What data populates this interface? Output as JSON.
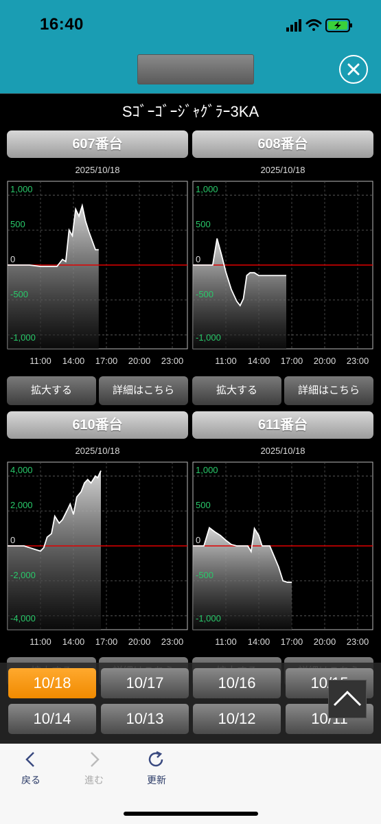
{
  "status": {
    "time": "16:40"
  },
  "title": "Sｺﾞｰｺﾞｰｼﾞｬｸﾞﾗｰ3KA",
  "buttons": {
    "zoom": "拡大する",
    "detail": "詳細はこちら"
  },
  "colors": {
    "header": "#1a9db3",
    "zero_line": "#e00000",
    "axis_label": "#29c96a",
    "active_date": "#f59a1c"
  },
  "panels": [
    {
      "title": "607番台",
      "date": "2025/10/18"
    },
    {
      "title": "608番台",
      "date": "2025/10/18"
    },
    {
      "title": "610番台",
      "date": "2025/10/18"
    },
    {
      "title": "611番台",
      "date": "2025/10/18"
    }
  ],
  "chart_data": [
    {
      "type": "area",
      "title": "607番台",
      "subtitle": "2025/10/18",
      "x_ticks": [
        "11:00",
        "14:00",
        "17:00",
        "20:00",
        "23:00"
      ],
      "y_ticks": [
        "1,000",
        "500",
        "0",
        "-500",
        "-1,000"
      ],
      "ylim": [
        -1100,
        1100
      ],
      "x": [
        8.0,
        9.0,
        10.0,
        11.0,
        11.5,
        12.0,
        12.5,
        13.0,
        13.3,
        13.6,
        13.9,
        14.2,
        14.5,
        14.8,
        15.1,
        15.4,
        15.7,
        16.0,
        16.3
      ],
      "y": [
        0,
        0,
        0,
        -20,
        -20,
        -20,
        -20,
        80,
        50,
        500,
        420,
        800,
        700,
        850,
        630,
        480,
        350,
        220,
        220
      ]
    },
    {
      "type": "area",
      "title": "608番台",
      "subtitle": "2025/10/18",
      "x_ticks": [
        "11:00",
        "14:00",
        "17:00",
        "20:00",
        "23:00"
      ],
      "y_ticks": [
        "1,000",
        "500",
        "0",
        "-500",
        "-1,000"
      ],
      "ylim": [
        -1100,
        1100
      ],
      "x": [
        8.0,
        9.0,
        9.8,
        10.2,
        10.6,
        11.0,
        11.5,
        12.0,
        12.3,
        12.6,
        12.9,
        13.2,
        13.6,
        14.0,
        15.0,
        16.0,
        16.5
      ],
      "y": [
        0,
        0,
        0,
        380,
        150,
        -100,
        -350,
        -520,
        -580,
        -480,
        -150,
        -110,
        -110,
        -150,
        -150,
        -150,
        -150
      ]
    },
    {
      "type": "area",
      "title": "610番台",
      "subtitle": "2025/10/18",
      "x_ticks": [
        "11:00",
        "14:00",
        "17:00",
        "20:00",
        "23:00"
      ],
      "y_ticks": [
        "4,000",
        "2,000",
        "0",
        "-2,000",
        "-4,000"
      ],
      "ylim": [
        -4400,
        4400
      ],
      "x": [
        8.0,
        9.5,
        10.0,
        10.5,
        11.0,
        11.3,
        11.6,
        12.0,
        12.3,
        12.7,
        13.0,
        13.4,
        13.7,
        14.0,
        14.3,
        14.7,
        15.0,
        15.3,
        15.6,
        16.0,
        16.2,
        16.5
      ],
      "y": [
        0,
        0,
        -100,
        -200,
        -300,
        -100,
        500,
        700,
        1700,
        1300,
        1500,
        2000,
        2400,
        1800,
        2800,
        3100,
        3600,
        3800,
        3600,
        4000,
        3900,
        4300
      ]
    },
    {
      "type": "area",
      "title": "611番台",
      "subtitle": "2025/10/18",
      "x_ticks": [
        "11:00",
        "14:00",
        "17:00",
        "20:00",
        "23:00"
      ],
      "y_ticks": [
        "1,000",
        "500",
        "0",
        "-500",
        "-1,000"
      ],
      "ylim": [
        -1100,
        1100
      ],
      "x": [
        8.0,
        9.0,
        9.5,
        10.0,
        10.5,
        11.0,
        11.5,
        12.0,
        12.5,
        13.0,
        13.3,
        13.6,
        14.0,
        14.3,
        14.6,
        15.0,
        15.4,
        15.8,
        16.2,
        16.6,
        17.0
      ],
      "y": [
        0,
        0,
        260,
        200,
        150,
        80,
        20,
        0,
        0,
        0,
        -80,
        250,
        150,
        0,
        0,
        0,
        -150,
        -300,
        -500,
        -520,
        -520
      ]
    }
  ],
  "dates": [
    "10/18",
    "10/17",
    "10/16",
    "10/15",
    "10/14",
    "10/13",
    "10/12",
    "10/11"
  ],
  "toolbar": {
    "back": "戻る",
    "forward": "進む",
    "reload": "更新"
  }
}
